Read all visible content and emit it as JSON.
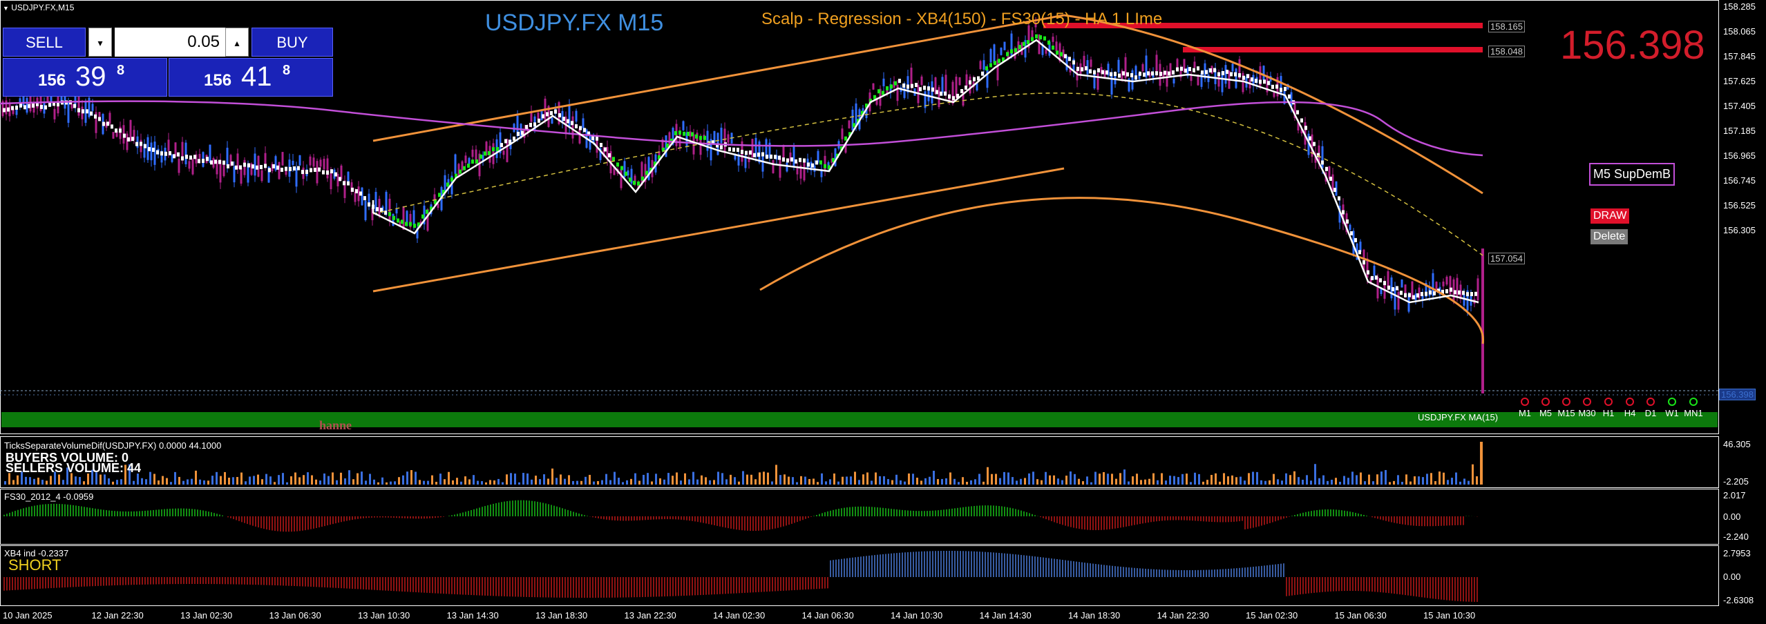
{
  "window": {
    "symbol_caption": "USDJPY.FX,M15"
  },
  "chart_title": {
    "symbol": "USDJPY.FX M15",
    "template": "Scalp - Regression - XB4(150) - FS30(15) - HA  1 LIme"
  },
  "current_price": "156.398",
  "trade_panel": {
    "sell_label": "SELL",
    "buy_label": "BUY",
    "lot": "0.05",
    "down_arrow": "▾",
    "up_arrow": "▴",
    "bid": {
      "big": "156",
      "pips": "39",
      "frac": "8"
    },
    "ask": {
      "big": "156",
      "pips": "41",
      "frac": "8"
    }
  },
  "side_panel": {
    "supdem_label": "M5 SupDemB",
    "draw_label": "DRAW",
    "delete_label": "Delete"
  },
  "level_tags": [
    "158.165",
    "158.048",
    "157.054",
    "156.398"
  ],
  "price_axis": [
    "158.285",
    "158.065",
    "157.845",
    "157.625",
    "157.405",
    "157.185",
    "156.965",
    "156.745",
    "156.525",
    "156.305"
  ],
  "ma_label": "USDJPY.FX MA(15)",
  "watermark": "hanne",
  "timeframes": [
    "M1",
    "M5",
    "M15",
    "M30",
    "H1",
    "H4",
    "D1",
    "W1",
    "MN1"
  ],
  "volume_panel": {
    "title": "TicksSeparateVolumeDif(USDJPY.FX) 0.0000 44.1000",
    "buyers": "BUYERS VOLUME: 0",
    "sellers": "SELLERS VOLUME: 44",
    "axis": [
      "46.305",
      "-2.205"
    ]
  },
  "fs30_panel": {
    "title": "FS30_2012_4 -0.0959",
    "axis": [
      "2.017",
      "0.00",
      "-2.240"
    ]
  },
  "xb4_panel": {
    "title": "XB4 ind -0.2337",
    "signal": "SHORT",
    "axis": [
      "2.7953",
      "0.00",
      "-2.6308"
    ]
  },
  "time_axis": [
    "10 Jan 2025",
    "12 Jan 22:30",
    "13 Jan 02:30",
    "13 Jan 06:30",
    "13 Jan 10:30",
    "13 Jan 14:30",
    "13 Jan 18:30",
    "13 Jan 22:30",
    "14 Jan 02:30",
    "14 Jan 06:30",
    "14 Jan 10:30",
    "14 Jan 14:30",
    "14 Jan 18:30",
    "14 Jan 22:30",
    "15 Jan 02:30",
    "15 Jan 06:30",
    "15 Jan 10:30"
  ],
  "colors": {
    "bull": "#2f6dff",
    "bear": "#b0208a",
    "ha_green": "#19e619",
    "ha_white": "#ffffff",
    "ma_white": "#ffffff",
    "ma_violet": "#c24fd8",
    "channel": "#f0923a",
    "level_red": "#e0102a",
    "price_red": "#d31d2b",
    "title_blue": "#3f8fe0",
    "title_orange": "#f0a020"
  }
}
